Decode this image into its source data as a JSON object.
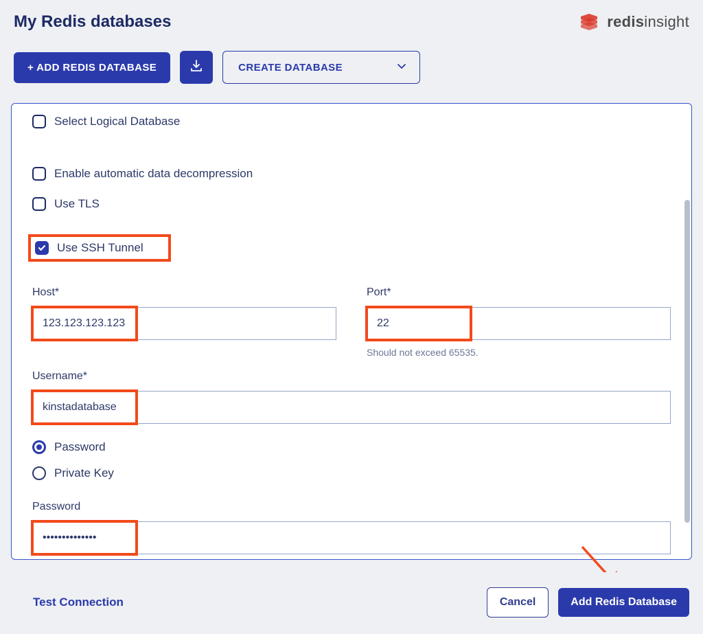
{
  "page": {
    "title": "My Redis databases",
    "brand_bold": "redis",
    "brand_light": "insight"
  },
  "toolbar": {
    "add_label": "+ ADD REDIS DATABASE",
    "create_label": "CREATE DATABASE"
  },
  "options": {
    "select_logical": "Select Logical Database",
    "auto_decompress": "Enable automatic data decompression",
    "use_tls": "Use TLS",
    "use_ssh": "Use SSH Tunnel"
  },
  "form": {
    "host_label": "Host*",
    "host_value": "123.123.123.123",
    "port_label": "Port*",
    "port_value": "22",
    "port_help": "Should not exceed 65535.",
    "username_label": "Username*",
    "username_value": "kinstadatabase",
    "auth_password_label": "Password",
    "auth_private_key_label": "Private Key",
    "password_label": "Password",
    "password_value": "••••••••••••••"
  },
  "footer": {
    "test": "Test Connection",
    "cancel": "Cancel",
    "submit": "Add Redis Database"
  },
  "colors": {
    "primary": "#2b3aab",
    "highlight": "#f24a1a"
  }
}
